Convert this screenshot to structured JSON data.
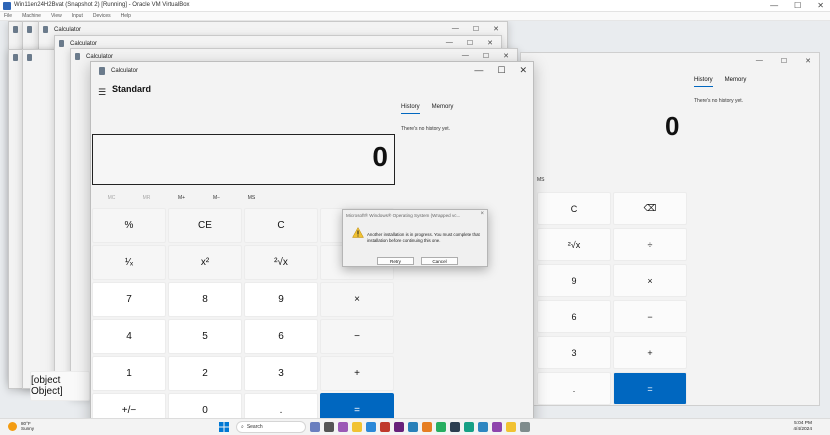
{
  "host": {
    "window_title": "Win11en24H2Bvat (Snapshot 2) [Running] - Oracle VM VirtualBox",
    "menu": [
      "File",
      "Machine",
      "View",
      "Input",
      "Devices",
      "Help"
    ]
  },
  "background_windows": {
    "title": "Calculator"
  },
  "calculator": {
    "title": "Calculator",
    "mode": "Standard",
    "display_value": "0",
    "history_tab": "History",
    "memory_tab": "Memory",
    "history_empty": "There's no history yet.",
    "memory_buttons": [
      {
        "label": "MC",
        "enabled": false
      },
      {
        "label": "MR",
        "enabled": false
      },
      {
        "label": "M+",
        "enabled": true
      },
      {
        "label": "M−",
        "enabled": true
      },
      {
        "label": "MS",
        "enabled": true
      }
    ],
    "keys": [
      {
        "label": "%",
        "kind": "op"
      },
      {
        "label": "CE",
        "kind": "op"
      },
      {
        "label": "C",
        "kind": "op"
      },
      {
        "label": "⌫",
        "kind": "op"
      },
      {
        "label": "¹⁄ₓ",
        "kind": "op"
      },
      {
        "label": "x²",
        "kind": "op"
      },
      {
        "label": "²√x",
        "kind": "op"
      },
      {
        "label": "÷",
        "kind": "op"
      },
      {
        "label": "7",
        "kind": "num"
      },
      {
        "label": "8",
        "kind": "num"
      },
      {
        "label": "9",
        "kind": "num"
      },
      {
        "label": "×",
        "kind": "op"
      },
      {
        "label": "4",
        "kind": "num"
      },
      {
        "label": "5",
        "kind": "num"
      },
      {
        "label": "6",
        "kind": "num"
      },
      {
        "label": "−",
        "kind": "op"
      },
      {
        "label": "1",
        "kind": "num"
      },
      {
        "label": "2",
        "kind": "num"
      },
      {
        "label": "3",
        "kind": "num"
      },
      {
        "label": "+",
        "kind": "op"
      },
      {
        "label": "+/−",
        "kind": "num"
      },
      {
        "label": "0",
        "kind": "num"
      },
      {
        "label": ".",
        "kind": "num"
      },
      {
        "label": "=",
        "kind": "eq"
      }
    ]
  },
  "right_calculator": {
    "history_tab": "History",
    "memory_tab": "Memory",
    "history_empty": "There's no history yet.",
    "display_value": "0",
    "ms_label": "MS",
    "keys": [
      "C",
      "⌫",
      "²√x",
      "÷",
      "9",
      "×",
      "6",
      "−",
      "3",
      "+",
      ".",
      "="
    ]
  },
  "dialog": {
    "title": "Microsoft® Windows® Operating System (Wrapped vc...",
    "close": "×",
    "message": "Another installation is in progress. You must complete that installation before continuing this one.",
    "retry_label": "Retry",
    "cancel_label": "Cancel"
  },
  "taskbar": {
    "temperature": "80°F",
    "condition": "Sunny",
    "search_placeholder": "Search",
    "time": "5:04 PM",
    "date": "4/4/2024"
  },
  "colors": {
    "accent": "#0067c0",
    "warning": "#f1c232"
  }
}
